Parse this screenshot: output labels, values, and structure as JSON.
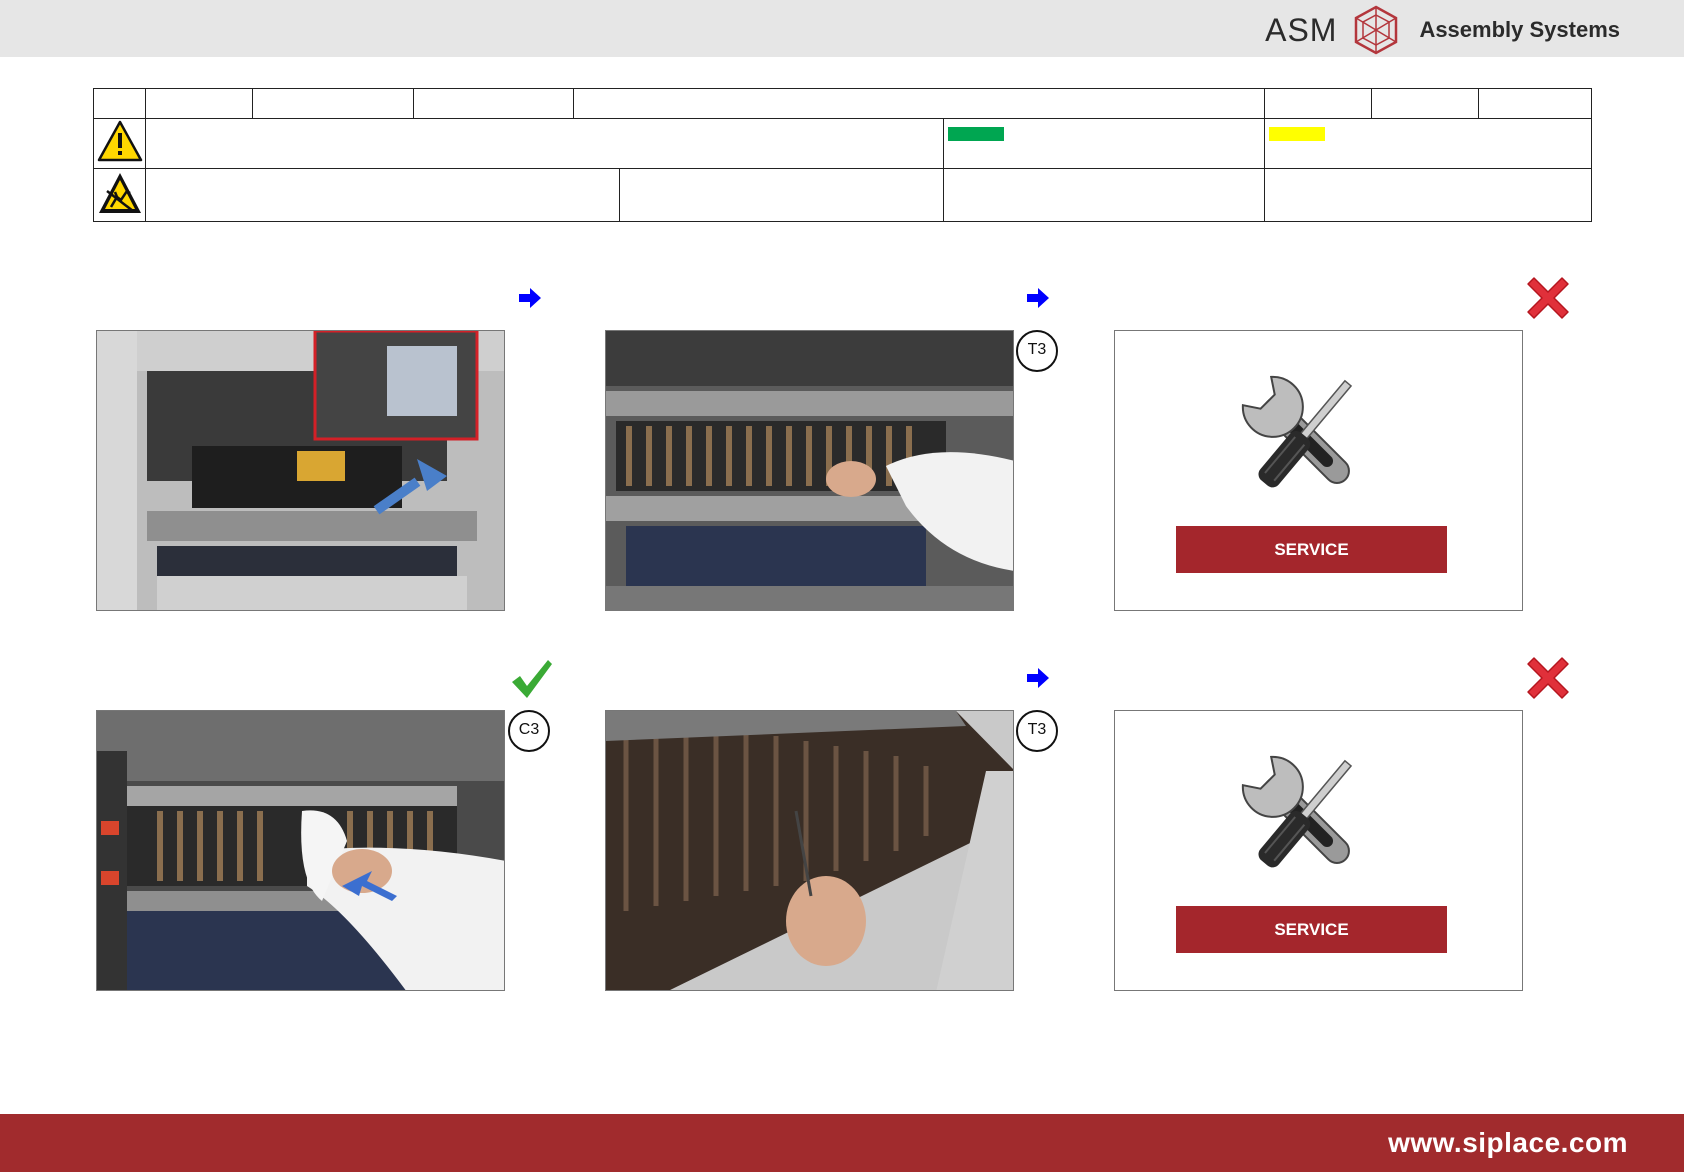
{
  "header": {
    "logo_text": "ASM",
    "logo_subtitle": "Assembly Systems"
  },
  "info_table": {
    "status_colors": {
      "green": "#00a651",
      "yellow": "#ffff00"
    },
    "icons": [
      "warning-triangle-icon",
      "esd-warning-icon"
    ]
  },
  "steps": [
    {
      "id": 1,
      "photo": "machine-cover-open-photo",
      "next": "arrow"
    },
    {
      "id": 2,
      "photo": "nozzle-changer-pick-photo",
      "tool_badge": "T3",
      "next": "arrow"
    },
    {
      "id": 3,
      "service_label": "SERVICE",
      "status": "cross"
    },
    {
      "id": 4,
      "photo": "wipe-cleaning-photo",
      "tool_badge": "C3",
      "status": "check"
    },
    {
      "id": 5,
      "photo": "tweezers-inspection-photo",
      "tool_badge": "T3",
      "next": "arrow"
    },
    {
      "id": 6,
      "service_label": "SERVICE",
      "status": "cross"
    }
  ],
  "footer": {
    "url": "www.siplace.com"
  },
  "colors": {
    "footer_bg": "#a12b2d",
    "service_bar": "#a4262c",
    "arrow": "#0000ff",
    "cross": "#e0303a",
    "check": "#3aaa35"
  }
}
